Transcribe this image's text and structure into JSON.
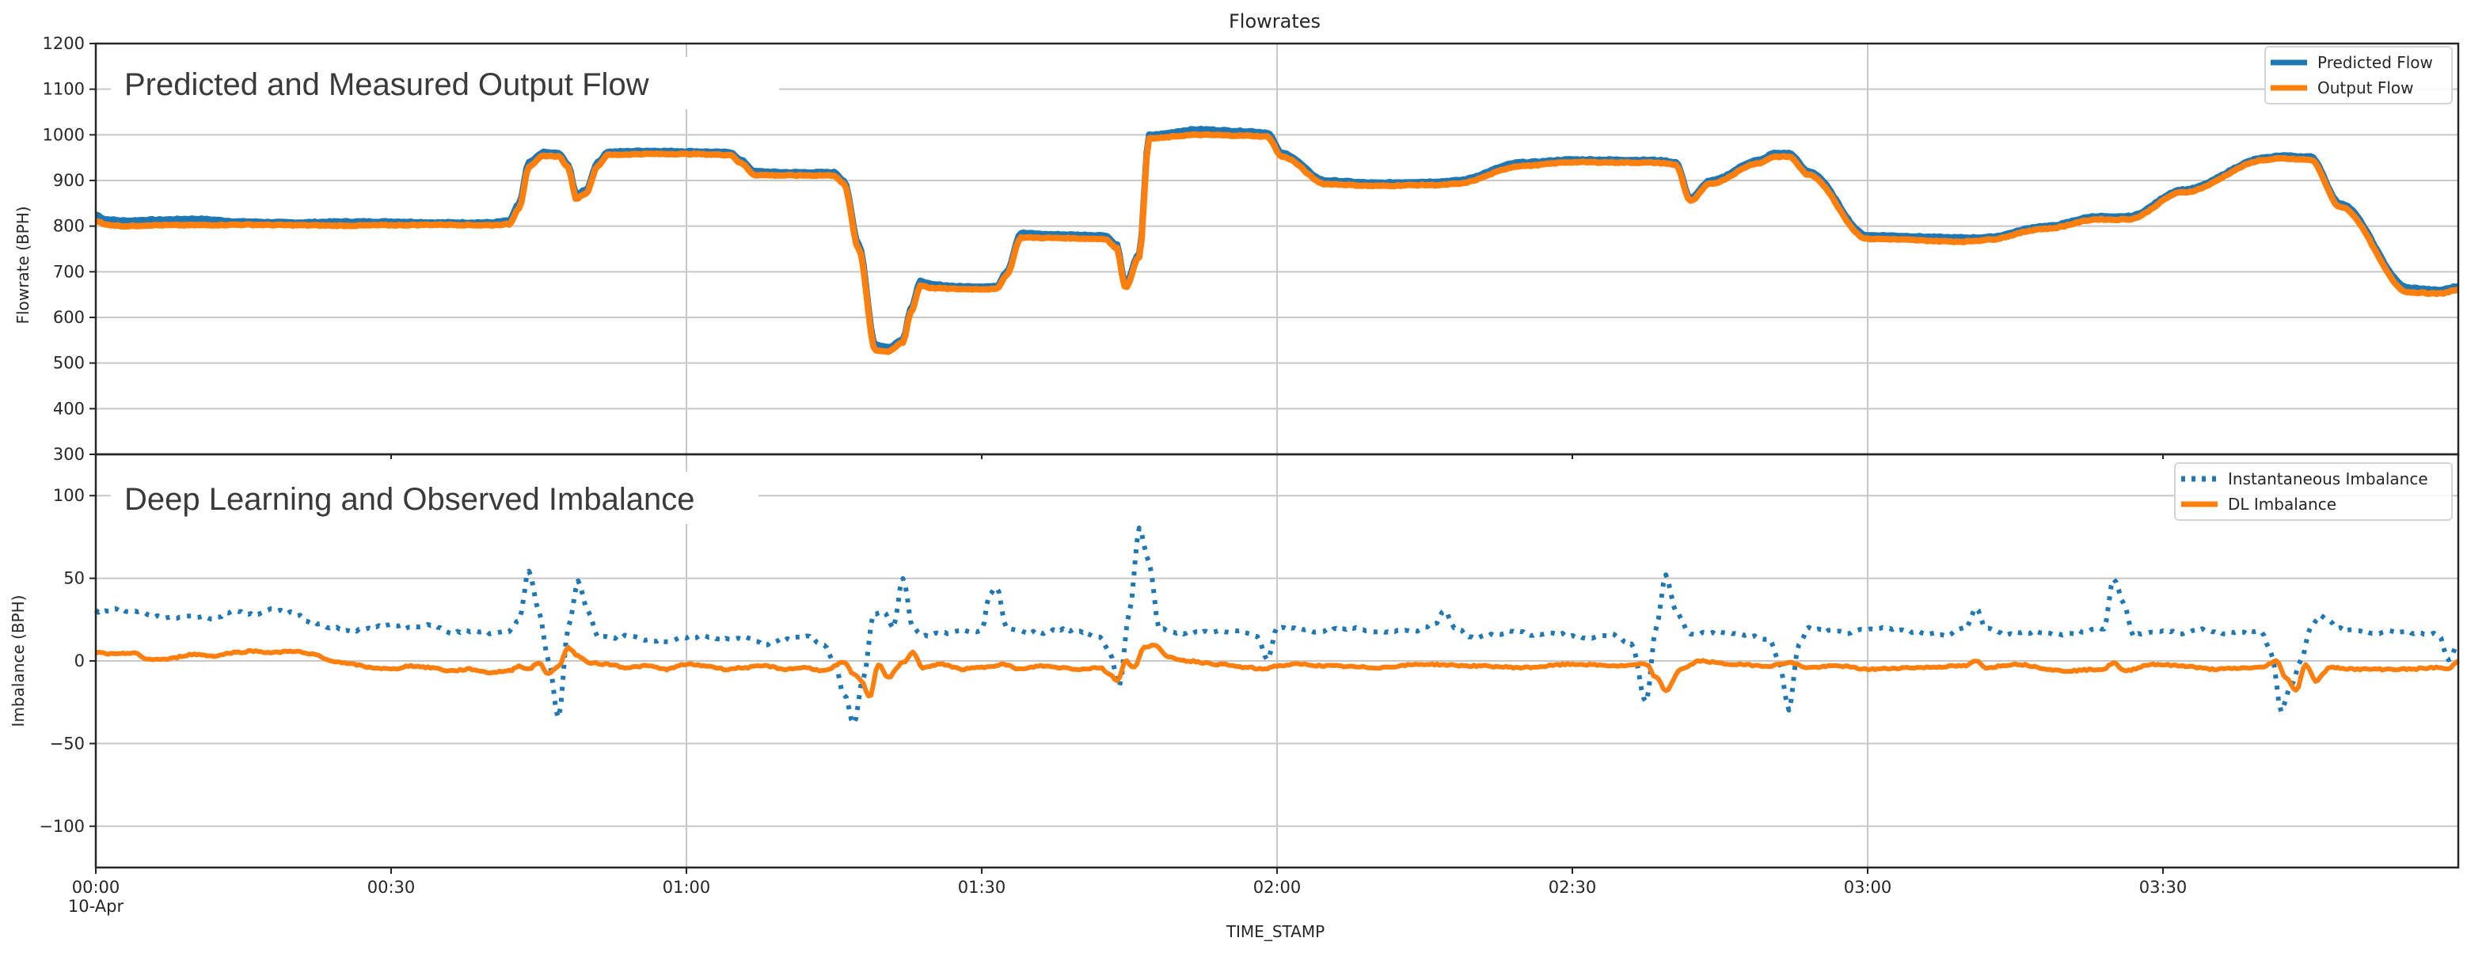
{
  "chart_data": [
    {
      "type": "line",
      "title": "Flowrates",
      "inset_title": "Predicted and Measured Output Flow",
      "xlabel": "",
      "ylabel": "Flowrate (BPH)",
      "xlim_minutes": [
        0,
        240
      ],
      "ylim": [
        300,
        1200
      ],
      "yticks": [
        300,
        400,
        500,
        600,
        700,
        800,
        900,
        1000,
        1100,
        1200
      ],
      "grid": true,
      "legend_position": "top-right",
      "series": [
        {
          "name": "Predicted Flow",
          "color": "#1f77b4",
          "style": "solid",
          "x_minutes": [
            0,
            1,
            3,
            6,
            10,
            15,
            20,
            25,
            30,
            35,
            40,
            42,
            43,
            44,
            45.5,
            47,
            48,
            48.8,
            49.8,
            51,
            52,
            56,
            60,
            64.5,
            65.5,
            67,
            70,
            75,
            76,
            77.5,
            79.2,
            80.5,
            82,
            82.8,
            83.8,
            85,
            88,
            91.5,
            92.5,
            94,
            97,
            102.5,
            103.7,
            104.6,
            106,
            107,
            112,
            117,
            119,
            120.5,
            125,
            130,
            135,
            136.5,
            138,
            145,
            150,
            158,
            159.2,
            160.5,
            162,
            164,
            169,
            170.5,
            172,
            174,
            180,
            190,
            191,
            192,
            198,
            203.5,
            205,
            206.5,
            212,
            220.5,
            222,
            224,
            225,
            228,
            235,
            238,
            240
          ],
          "values": [
            825,
            815,
            812,
            814,
            816,
            810,
            808,
            810,
            810,
            808,
            808,
            812,
            850,
            940,
            962,
            960,
            935,
            870,
            880,
            940,
            963,
            965,
            964,
            962,
            945,
            920,
            918,
            918,
            900,
            760,
            540,
            535,
            552,
            620,
            680,
            672,
            668,
            668,
            700,
            785,
            782,
            780,
            760,
            672,
            740,
            1000,
            1012,
            1008,
            1005,
            960,
            900,
            895,
            897,
            898,
            900,
            940,
            946,
            945,
            944,
            940,
            862,
            900,
            945,
            960,
            960,
            920,
            780,
            775,
            775,
            776,
            800,
            822,
            820,
            822,
            880,
            950,
            955,
            953,
            952,
            850,
            665,
            660,
            668,
            666,
            664,
            615
          ]
        },
        {
          "name": "Output Flow",
          "color": "#ff7f0e",
          "style": "solid",
          "x_minutes": [
            0,
            1,
            3,
            6,
            10,
            15,
            20,
            25,
            30,
            35,
            40,
            42,
            43,
            44,
            45.5,
            47,
            48,
            48.8,
            49.8,
            51,
            52,
            56,
            60,
            64.5,
            65.5,
            67,
            70,
            75,
            76,
            77.5,
            79.2,
            80.5,
            82,
            82.8,
            83.8,
            85,
            88,
            91.5,
            92.5,
            94,
            97,
            102.5,
            103.7,
            104.6,
            106,
            107,
            112,
            117,
            119,
            120.5,
            125,
            130,
            135,
            136.5,
            138,
            145,
            150,
            158,
            159.2,
            160.5,
            162,
            164,
            169,
            170.5,
            172,
            174,
            180,
            190,
            191,
            192,
            198,
            203.5,
            205,
            206.5,
            212,
            220.5,
            222,
            224,
            225,
            228,
            235,
            238,
            240
          ],
          "values": [
            812,
            803,
            800,
            802,
            802,
            803,
            802,
            801,
            802,
            803,
            802,
            804,
            840,
            930,
            954,
            953,
            928,
            860,
            872,
            932,
            956,
            958,
            958,
            956,
            938,
            912,
            911,
            911,
            892,
            750,
            528,
            525,
            545,
            612,
            670,
            664,
            662,
            662,
            692,
            775,
            774,
            772,
            752,
            665,
            732,
            992,
            1000,
            998,
            996,
            952,
            892,
            888,
            890,
            890,
            892,
            932,
            940,
            939,
            938,
            934,
            855,
            893,
            938,
            952,
            952,
            912,
            772,
            766,
            768,
            770,
            794,
            815,
            814,
            815,
            874,
            945,
            948,
            946,
            945,
            842,
            655,
            652,
            660,
            660,
            657,
            612
          ]
        }
      ]
    },
    {
      "type": "line",
      "title": "",
      "inset_title": "Deep Learning and Observed Imbalance",
      "xlabel": "TIME_STAMP",
      "ylabel": "Imbalance (BPH)",
      "xlim_minutes": [
        0,
        240
      ],
      "ylim": [
        -125,
        125
      ],
      "yticks": [
        -100,
        -50,
        0,
        50,
        100
      ],
      "xticks": [
        "00:00\n10-Apr",
        "00:30",
        "01:00",
        "01:30",
        "02:00",
        "02:30",
        "03:00",
        "03:30"
      ],
      "xtick_minutes": [
        0,
        30,
        60,
        90,
        120,
        150,
        180,
        210
      ],
      "grid": true,
      "legend_position": "top-right",
      "series": [
        {
          "name": "Instantaneous Imbalance",
          "color": "#1f77b4",
          "style": "dotted",
          "x_minutes": [
            0,
            2,
            4,
            6,
            8,
            10,
            12,
            14,
            16,
            18,
            20,
            22,
            24,
            26,
            28,
            30,
            32,
            34,
            36,
            38,
            40,
            42,
            43,
            44,
            45,
            46,
            47,
            48,
            49,
            50,
            51,
            52,
            54,
            56,
            58,
            60,
            62,
            64,
            66,
            68,
            70,
            72,
            74,
            75,
            76,
            77,
            78,
            79,
            80,
            81,
            82,
            83,
            84,
            86,
            88,
            90,
            90.8,
            91.5,
            92.5,
            94,
            96,
            98,
            100,
            102,
            103,
            104,
            105,
            106,
            107,
            108,
            110,
            112,
            114,
            116,
            118,
            119,
            120,
            122,
            124,
            126,
            128,
            130,
            132,
            134,
            136,
            137,
            138,
            140,
            142,
            144,
            146,
            148,
            150,
            152,
            154,
            156,
            157.5,
            158.5,
            159.5,
            160.5,
            162,
            164,
            166,
            168,
            170,
            171,
            172,
            173,
            174,
            176,
            178,
            180,
            182,
            184,
            186,
            188,
            190,
            191,
            192,
            194,
            196,
            198,
            200,
            202,
            204,
            205,
            206,
            207,
            208,
            210,
            212,
            214,
            216,
            218,
            220,
            221,
            222,
            223,
            224,
            225,
            226,
            228,
            230,
            232,
            234,
            236,
            238,
            239,
            240
          ],
          "values": [
            30,
            31,
            30,
            27,
            26,
            27,
            26,
            30,
            28,
            31,
            29,
            23,
            20,
            18,
            20,
            22,
            20,
            22,
            17,
            18,
            17,
            18,
            25,
            55,
            30,
            0,
            -35,
            20,
            48,
            30,
            15,
            14,
            15,
            13,
            12,
            14,
            15,
            13,
            14,
            10,
            13,
            15,
            10,
            0,
            -20,
            -38,
            -10,
            28,
            30,
            20,
            50,
            20,
            15,
            17,
            18,
            18,
            40,
            45,
            20,
            18,
            17,
            19,
            18,
            14,
            5,
            -15,
            30,
            80,
            60,
            20,
            17,
            17,
            18,
            18,
            15,
            0,
            20,
            20,
            18,
            19,
            20,
            17,
            18,
            18,
            22,
            31,
            20,
            14,
            16,
            18,
            16,
            17,
            15,
            14,
            16,
            10,
            -25,
            20,
            52,
            30,
            16,
            17,
            17,
            15,
            13,
            0,
            -30,
            10,
            20,
            18,
            17,
            19,
            20,
            18,
            17,
            16,
            20,
            32,
            20,
            16,
            17,
            17,
            16,
            18,
            20,
            50,
            35,
            15,
            17,
            18,
            17,
            19,
            17,
            17,
            18,
            5,
            -30,
            -15,
            0,
            20,
            27,
            20,
            18,
            17,
            18,
            17,
            16,
            0,
            10
          ]
        },
        {
          "name": "DL Imbalance",
          "color": "#ff7f0e",
          "style": "solid",
          "x_minutes": [
            0,
            2,
            4,
            5,
            7,
            10,
            12,
            14,
            16,
            18,
            20,
            22,
            24,
            26,
            28,
            30,
            32,
            34,
            36,
            38,
            40,
            42,
            43,
            44,
            45,
            46,
            47,
            48,
            49,
            50,
            52,
            54,
            56,
            58,
            60,
            62,
            64,
            66,
            68,
            70,
            72,
            74,
            76,
            77,
            77.8,
            78.6,
            79.5,
            80.5,
            82,
            83,
            84,
            86,
            88,
            90,
            91,
            92,
            94,
            96,
            98,
            100,
            102,
            103,
            103.8,
            104.6,
            105.5,
            106.5,
            107.5,
            109,
            111,
            114,
            117,
            118.5,
            120,
            122,
            125,
            130,
            135,
            140,
            145,
            150,
            155,
            157.5,
            158.5,
            159.5,
            161,
            163,
            166,
            170,
            172,
            174,
            177,
            180,
            185,
            190,
            191,
            192,
            195,
            200,
            204,
            205,
            206,
            209,
            212,
            215,
            220,
            221.5,
            222.5,
            223.5,
            224.5,
            225.5,
            227,
            230,
            235,
            238,
            239,
            240
          ],
          "values": [
            5,
            4,
            5,
            1,
            1,
            4,
            3,
            5,
            6,
            5,
            6,
            4,
            0,
            -2,
            -4,
            -5,
            -3,
            -4,
            -6,
            -5,
            -7,
            -6,
            -3,
            -5,
            -1,
            -8,
            -3,
            8,
            3,
            -1,
            -2,
            -4,
            -3,
            -5,
            -2,
            -3,
            -5,
            -4,
            -3,
            -5,
            -4,
            -6,
            -1,
            -8,
            -12,
            -22,
            -2,
            -10,
            -1,
            5,
            -4,
            -2,
            -5,
            -4,
            -3,
            -2,
            -5,
            -3,
            -4,
            -5,
            -4,
            -8,
            -12,
            0,
            -4,
            8,
            10,
            2,
            0,
            -2,
            -4,
            -5,
            -3,
            -2,
            -3,
            -4,
            -2,
            -3,
            -4,
            -2,
            -3,
            -2,
            -10,
            -18,
            -5,
            0,
            -2,
            -3,
            -1,
            -4,
            -3,
            -5,
            -4,
            -3,
            0,
            -4,
            -2,
            -6,
            -5,
            -1,
            -6,
            -2,
            -3,
            -5,
            -4,
            0,
            -10,
            -18,
            -2,
            -12,
            -4,
            -5,
            -5,
            -4,
            -5,
            0,
            -4
          ]
        }
      ]
    }
  ]
}
